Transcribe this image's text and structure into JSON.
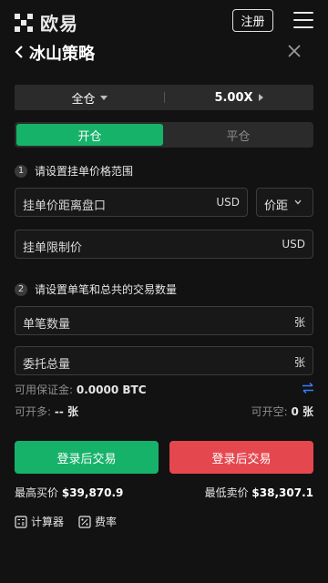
{
  "topbar": {
    "brand_name": "欧易",
    "register_label": "注册"
  },
  "header": {
    "title": "冰山策略"
  },
  "mode_bar": {
    "margin_mode": "全仓",
    "leverage": "5.00X"
  },
  "tabs": [
    {
      "label": "开仓",
      "active": true
    },
    {
      "label": "平仓",
      "active": false
    }
  ],
  "section1": {
    "number": "1",
    "label": "请设置挂单价格范围",
    "distance_placeholder": "挂单价距离盘口",
    "distance_unit": "USD",
    "distance_type": "价距",
    "limit_placeholder": "挂单限制价",
    "limit_unit": "USD"
  },
  "section2": {
    "number": "2",
    "label": "请设置单笔和总共的交易数量",
    "single_placeholder": "单笔数量",
    "single_unit": "张",
    "total_placeholder": "委托总量",
    "total_unit": "张"
  },
  "account": {
    "margin_label": "可用保证金:",
    "margin_value": "0.0000 BTC",
    "can_open_long_label": "可开多:",
    "can_open_long_value": "-- 张",
    "can_open_short_label": "可开空:",
    "can_open_short_value": "0 张"
  },
  "actions": {
    "buy_label": "登录后交易",
    "sell_label": "登录后交易"
  },
  "prices": {
    "max_buy_label": "最高买价",
    "max_buy_value": "$39,870.9",
    "min_sell_label": "最低卖价",
    "min_sell_value": "$38,307.1"
  },
  "tools": {
    "calculator_label": "计算器",
    "fee_label": "费率"
  },
  "colors": {
    "buy": "#17b26a",
    "sell": "#e5474f",
    "background": "#121212",
    "accent_link": "#3d7bfd"
  }
}
